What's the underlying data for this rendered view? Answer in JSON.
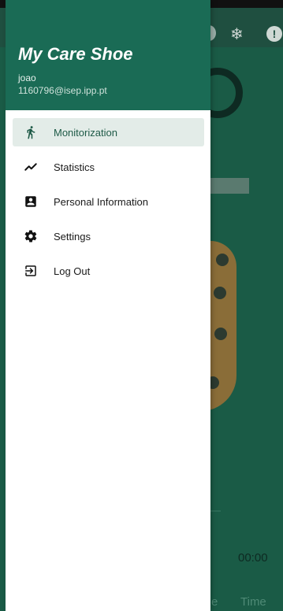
{
  "drawer": {
    "title": "My Care Shoe",
    "user_name": "joao",
    "user_email": "1160796@isep.ipp.pt",
    "items": [
      {
        "label": "Monitorization",
        "icon": "walking-person-icon",
        "active": true
      },
      {
        "label": "Statistics",
        "icon": "trend-line-icon",
        "active": false
      },
      {
        "label": "Personal Information",
        "icon": "contact-card-icon",
        "active": false
      },
      {
        "label": "Settings",
        "icon": "gear-icon",
        "active": false
      },
      {
        "label": "Log Out",
        "icon": "logout-icon",
        "active": false
      }
    ]
  },
  "background": {
    "timer": "00:00",
    "tab_partial": "e",
    "tab_time": "Time"
  },
  "colors": {
    "header": "#1a6b55",
    "active_bg": "#e3ece8",
    "active_text": "#1e5a47",
    "scrim_bg": "#1a5b46"
  }
}
